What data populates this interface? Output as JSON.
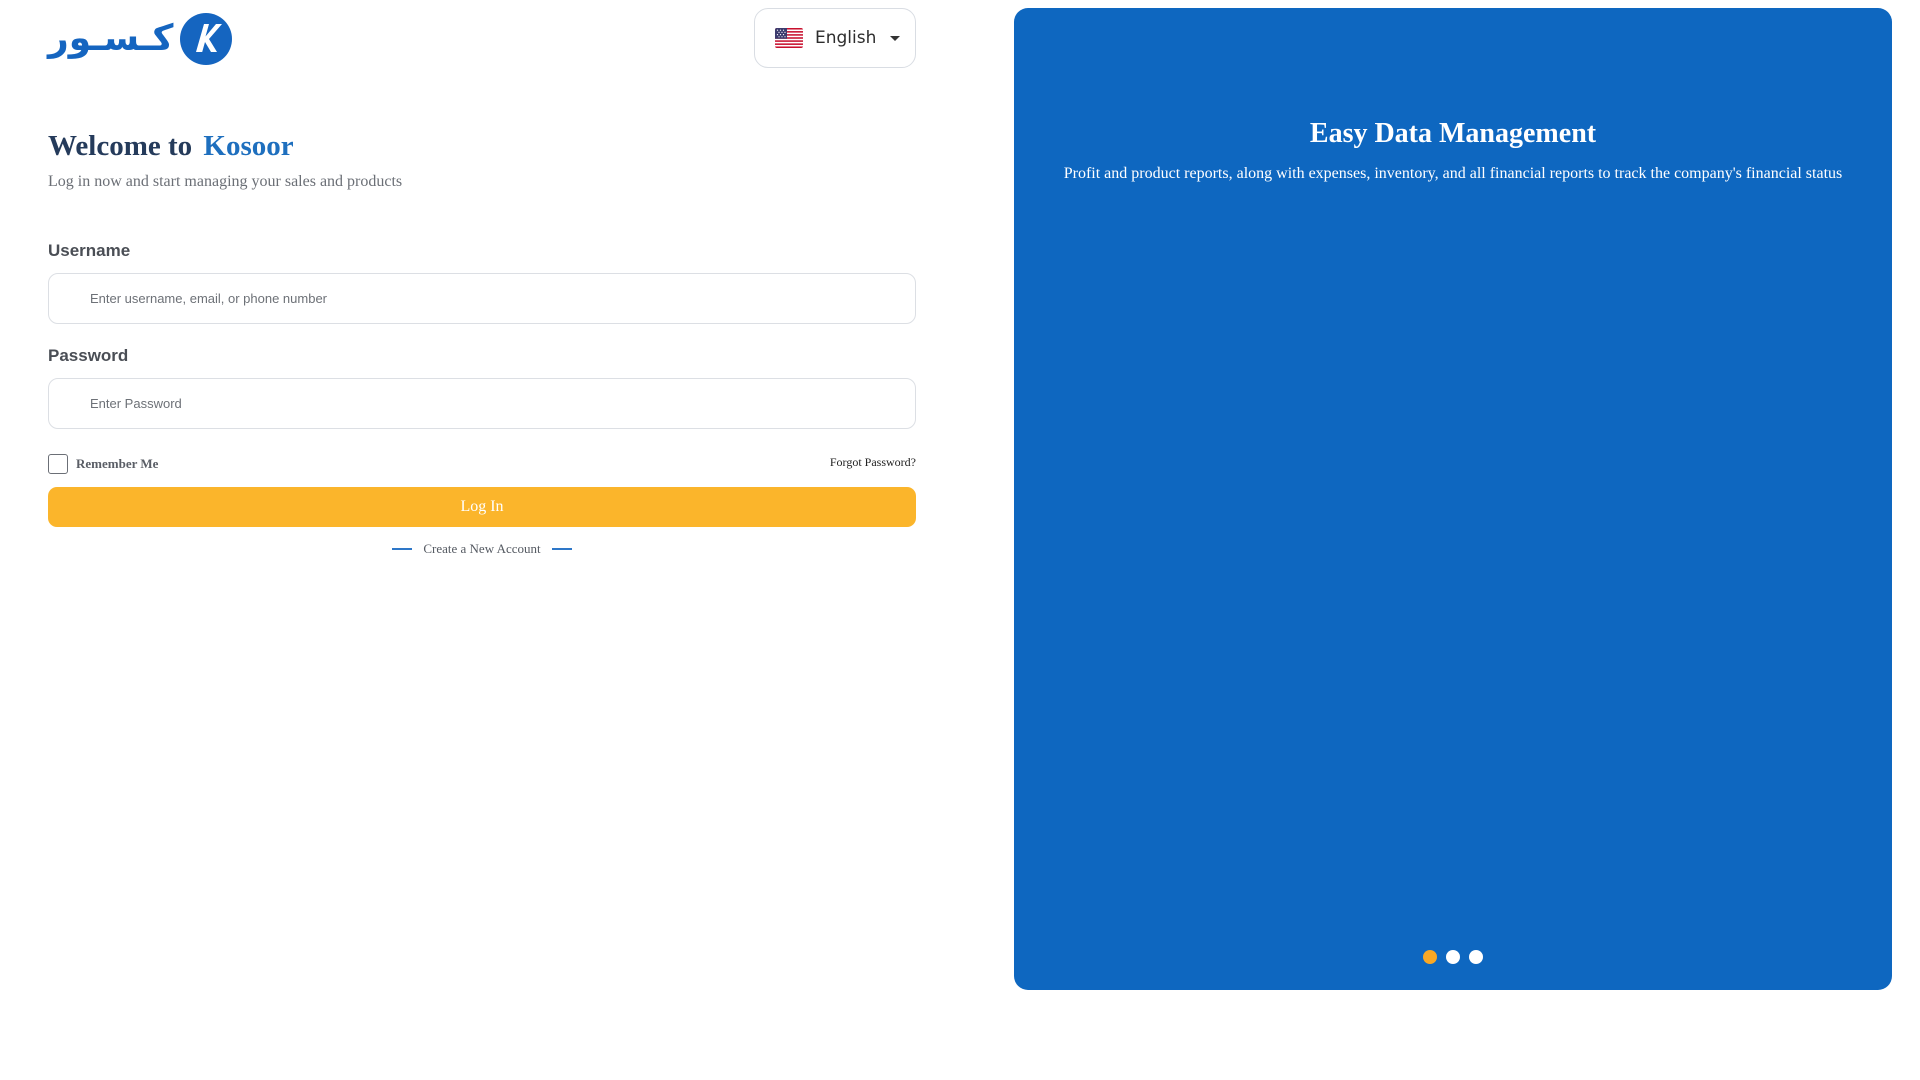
{
  "logo": {
    "wordmark": "كـسـور",
    "mark_letter": "K",
    "color": "#1565c0"
  },
  "language": {
    "label": "English",
    "flag_icon": "us-flag-icon"
  },
  "login": {
    "welcome_prefix": "Welcome to",
    "brand_name": "Kosoor",
    "subtitle": "Log in now and start managing your sales and products",
    "username_label": "Username",
    "username_placeholder": "Enter username, email, or phone number",
    "password_label": "Password",
    "password_placeholder": "Enter Password",
    "remember_label": "Remember Me",
    "forgot_label": "Forgot Password?",
    "login_label": "Log In",
    "create_account_label": "Create a New Account"
  },
  "carousel": {
    "title": "Easy Data Management",
    "description": "Profit and product reports, along with expenses, inventory, and all financial reports to track the company's financial status",
    "slide_count": 3,
    "active_slide": 0
  },
  "colors": {
    "primary": "#0e67c0",
    "accent": "#fbb52b",
    "active_dot": "#f9a825",
    "heading": "#253b5b"
  }
}
